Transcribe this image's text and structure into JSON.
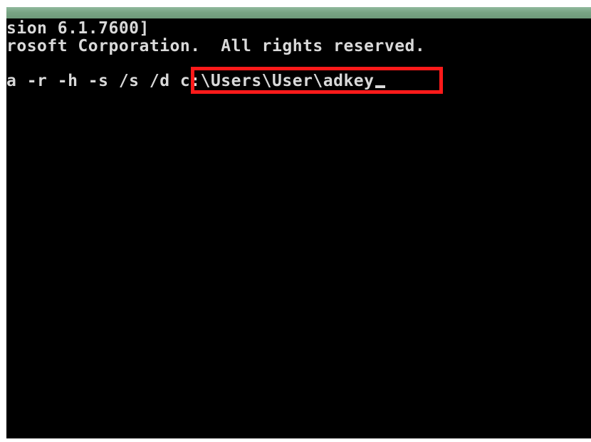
{
  "console": {
    "lines": [
      "sion 6.1.7600]",
      "rosoft Corporation.  All rights reserved.",
      "a -r -h -s /s /d "
    ],
    "command_path": "c:\\Users\\User\\adkey"
  },
  "colors": {
    "background": "#000000",
    "text": "#d9d9d9",
    "highlight": "#ff1a1a",
    "title_bar": "#79a585"
  }
}
